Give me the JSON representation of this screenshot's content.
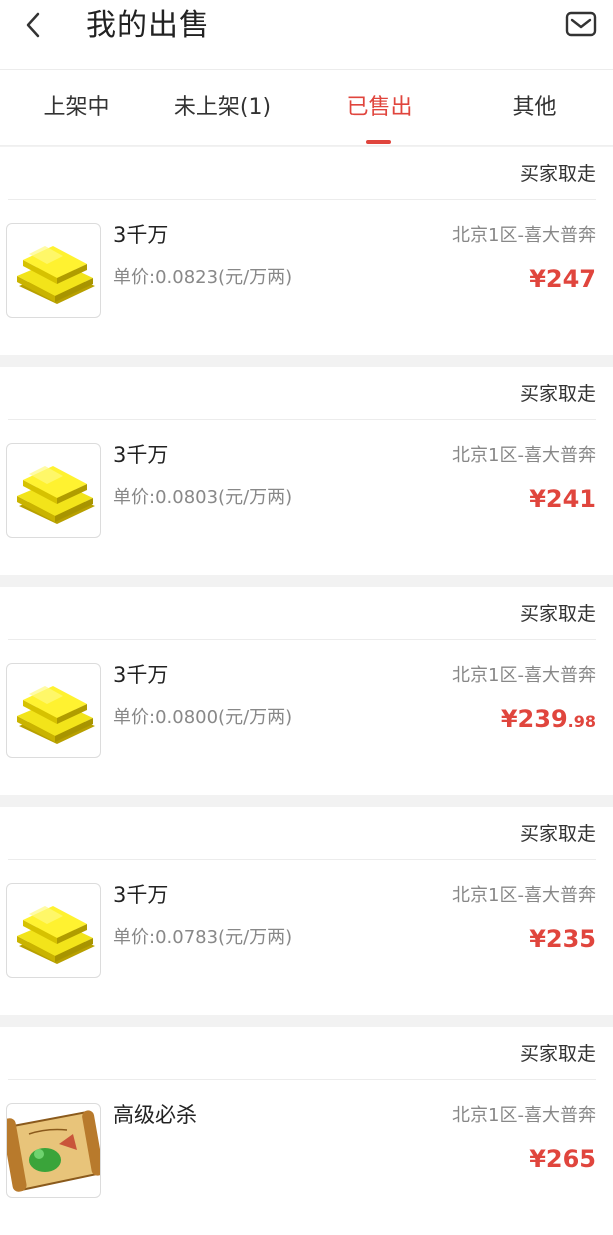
{
  "header": {
    "title": "我的出售",
    "back_icon": "chevron-left-icon",
    "mail_icon": "mail-icon"
  },
  "tabs": [
    {
      "label": "上架中"
    },
    {
      "label": "未上架(1)"
    },
    {
      "label": "已售出",
      "active": true
    },
    {
      "label": "其他"
    }
  ],
  "colors": {
    "accent": "#e0453d",
    "muted_text": "#888888"
  },
  "orders": [
    {
      "status": "买家取走",
      "name": "3千万",
      "unit_price": "单价:0.0823(元/万两)",
      "server": "北京1区-喜大普奔",
      "price_main": "¥247",
      "price_cents": "",
      "icon": "gold-bars-icon"
    },
    {
      "status": "买家取走",
      "name": "3千万",
      "unit_price": "单价:0.0803(元/万两)",
      "server": "北京1区-喜大普奔",
      "price_main": "¥241",
      "price_cents": "",
      "icon": "gold-bars-icon"
    },
    {
      "status": "买家取走",
      "name": "3千万",
      "unit_price": "单价:0.0800(元/万两)",
      "server": "北京1区-喜大普奔",
      "price_main": "¥239",
      "price_cents": ".98",
      "icon": "gold-bars-icon"
    },
    {
      "status": "买家取走",
      "name": "3千万",
      "unit_price": "单价:0.0783(元/万两)",
      "server": "北京1区-喜大普奔",
      "price_main": "¥235",
      "price_cents": "",
      "icon": "gold-bars-icon"
    },
    {
      "status": "买家取走",
      "name": "高级必杀",
      "unit_price": "",
      "server": "北京1区-喜大普奔",
      "price_main": "¥265",
      "price_cents": "",
      "icon": "skill-scroll-icon"
    }
  ]
}
